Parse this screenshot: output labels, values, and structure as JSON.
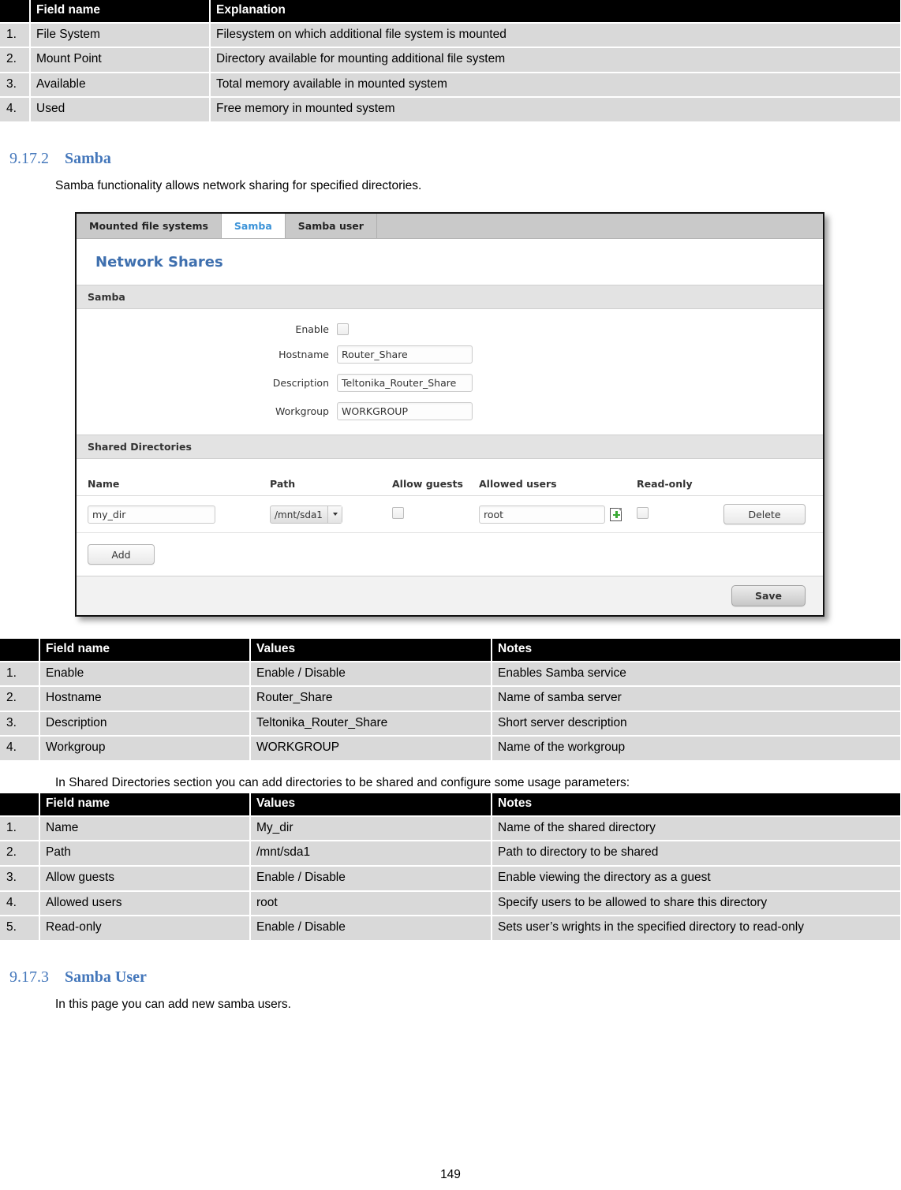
{
  "table_mounted": {
    "headers": [
      "",
      "Field name",
      "Explanation"
    ],
    "rows": [
      {
        "num": "1.",
        "field": "File System",
        "explanation": "Filesystem on which additional file system is mounted"
      },
      {
        "num": "2.",
        "field": "Mount Point",
        "explanation": "Directory available for mounting additional file system"
      },
      {
        "num": "3.",
        "field": "Available",
        "explanation": "Total memory available in mounted system"
      },
      {
        "num": "4.",
        "field": "Used",
        "explanation": "Free memory in mounted system"
      }
    ]
  },
  "section_samba": {
    "number": "9.17.2",
    "title": "Samba",
    "intro": "Samba functionality allows network sharing for specified directories."
  },
  "screenshot": {
    "tabs": [
      {
        "label": "Mounted file systems",
        "active": false
      },
      {
        "label": "Samba",
        "active": true
      },
      {
        "label": "Samba user",
        "active": false
      }
    ],
    "page_title": "Network Shares",
    "samba_section": {
      "heading": "Samba",
      "fields": [
        {
          "label": "Enable",
          "type": "checkbox",
          "value": ""
        },
        {
          "label": "Hostname",
          "type": "text",
          "value": "Router_Share"
        },
        {
          "label": "Description",
          "type": "text",
          "value": "Teltonika_Router_Share"
        },
        {
          "label": "Workgroup",
          "type": "text",
          "value": "WORKGROUP"
        }
      ]
    },
    "shared_directories": {
      "heading": "Shared Directories",
      "columns": [
        "Name",
        "Path",
        "Allow guests",
        "Allowed users",
        "Read-only",
        ""
      ],
      "row": {
        "name": "my_dir",
        "path": "/mnt/sda1",
        "allow_guests": false,
        "allowed_users": "root",
        "read_only": false,
        "delete_label": "Delete"
      },
      "add_label": "Add"
    },
    "save_label": "Save"
  },
  "table_samba": {
    "headers": [
      "",
      "Field name",
      "Values",
      "Notes"
    ],
    "rows": [
      {
        "num": "1.",
        "field": "Enable",
        "value": "Enable / Disable",
        "notes": "Enables Samba service"
      },
      {
        "num": "2.",
        "field": "Hostname",
        "value": "Router_Share",
        "notes": "Name of samba server"
      },
      {
        "num": "3.",
        "field": "Description",
        "value": "Teltonika_Router_Share",
        "notes": "Short server description"
      },
      {
        "num": "4.",
        "field": "Workgroup",
        "value": "WORKGROUP",
        "notes": "Name of the workgroup"
      }
    ]
  },
  "shared_dirs_intro": "In Shared Directories section you can add directories to be shared and configure some usage parameters:",
  "table_shared": {
    "headers": [
      "",
      "Field name",
      "Values",
      "Notes"
    ],
    "rows": [
      {
        "num": "1.",
        "field": "Name",
        "value": "My_dir",
        "notes": "Name of the shared directory"
      },
      {
        "num": "2.",
        "field": "Path",
        "value": "/mnt/sda1",
        "notes": "Path to directory to be shared"
      },
      {
        "num": "3.",
        "field": "Allow guests",
        "value": "Enable / Disable",
        "notes": "Enable viewing the directory as a guest"
      },
      {
        "num": "4.",
        "field": "Allowed users",
        "value": "root",
        "notes": "Specify users to be allowed to share this directory"
      },
      {
        "num": "5.",
        "field": "Read-only",
        "value": "Enable / Disable",
        "notes": "Sets user’s wrights in the specified directory to read-only"
      }
    ]
  },
  "section_samba_user": {
    "number": "9.17.3",
    "title": "Samba User",
    "intro": "In this page you can add new samba users."
  },
  "page_number": "149"
}
